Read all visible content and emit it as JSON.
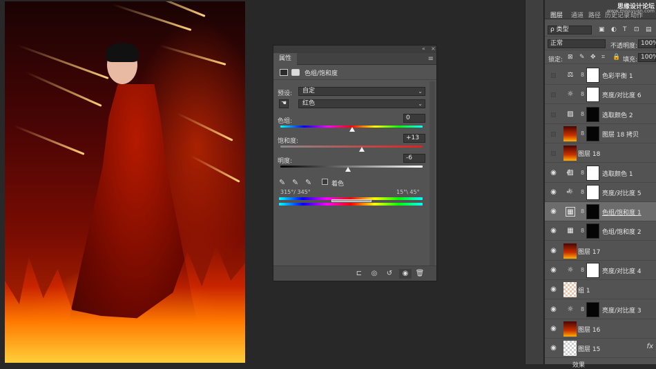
{
  "properties": {
    "tab": "属性",
    "title": "色组/饱和度",
    "preset_label": "预设:",
    "preset_value": "自定",
    "channel_value": "红色",
    "hue_label": "色组:",
    "hue_value": "0",
    "hue_fraction": 0.5,
    "saturation_label": "饱和度:",
    "saturation_value": "+13",
    "saturation_fraction": 0.565,
    "lightness_label": "明度:",
    "lightness_value": "-6",
    "lightness_fraction": 0.47,
    "colorize_label": "着色",
    "range_left": "315°/ 345°",
    "range_right": "15°\\ 45°"
  },
  "layers": {
    "tabs": [
      "图层",
      "通道",
      "路径",
      "历史记录",
      "动作"
    ],
    "watermark": "思缘设计论坛",
    "watermark_sub": "www.missyuan.com",
    "kind_filter": "ρ 类型",
    "blend_mode": "正常",
    "opacity_label": "不透明度:",
    "opacity_value": "100%",
    "lock_label": "锁定:",
    "fill_label": "填充:",
    "fill_value": "100%",
    "items": [
      {
        "name": "色彩平衡 1",
        "visible": false,
        "icon": "balance-icon",
        "mask": "white",
        "clipped": false,
        "selected": false
      },
      {
        "name": "亮度/对比度 6",
        "visible": false,
        "icon": "sun-icon",
        "mask": "white",
        "clipped": false,
        "selected": false
      },
      {
        "name": "选取颜色 2",
        "visible": false,
        "icon": "selective-color-icon",
        "mask": "black",
        "clipped": false,
        "selected": false
      },
      {
        "name": "图层 18 拷贝",
        "visible": false,
        "icon": "image-thumb",
        "mask": "black",
        "clipped": false,
        "selected": false
      },
      {
        "name": "图层 18",
        "visible": false,
        "icon": "image-thumb",
        "mask": "",
        "clipped": false,
        "selected": false
      },
      {
        "name": "选取颜色 1",
        "visible": true,
        "icon": "selective-color-icon",
        "mask": "white",
        "clipped": true,
        "selected": false
      },
      {
        "name": "亮度/对比度 5",
        "visible": true,
        "icon": "sun-icon",
        "mask": "white",
        "clipped": true,
        "selected": false
      },
      {
        "name": "色组/饱和度 1",
        "visible": true,
        "icon": "hue-sat-icon",
        "mask": "black",
        "clipped": false,
        "selected": true
      },
      {
        "name": "色组/饱和度 2",
        "visible": true,
        "icon": "hue-sat-icon",
        "mask": "black",
        "clipped": false,
        "selected": false
      },
      {
        "name": "图层 17",
        "visible": true,
        "icon": "image-thumb",
        "mask": "",
        "clipped": false,
        "selected": false
      },
      {
        "name": "亮度/对比度 4",
        "visible": true,
        "icon": "sun-icon",
        "mask": "white",
        "clipped": false,
        "selected": false
      },
      {
        "name": "组 1",
        "visible": true,
        "icon": "group-thumb",
        "mask": "",
        "clipped": false,
        "selected": false
      },
      {
        "name": "亮度/对比度 3",
        "visible": true,
        "icon": "sun-icon",
        "mask": "black",
        "clipped": false,
        "selected": false
      },
      {
        "name": "图层 16",
        "visible": true,
        "icon": "image-thumb",
        "mask": "",
        "clipped": false,
        "selected": false
      },
      {
        "name": "图层 15",
        "visible": true,
        "icon": "transparent-thumb",
        "mask": "",
        "clipped": false,
        "selected": false,
        "fx": "fx"
      }
    ],
    "effects_label": "效果"
  },
  "colors": {
    "panel_bg": "#535353",
    "selected_row": "#6c6c6c",
    "canvas_bg": "#282828"
  }
}
